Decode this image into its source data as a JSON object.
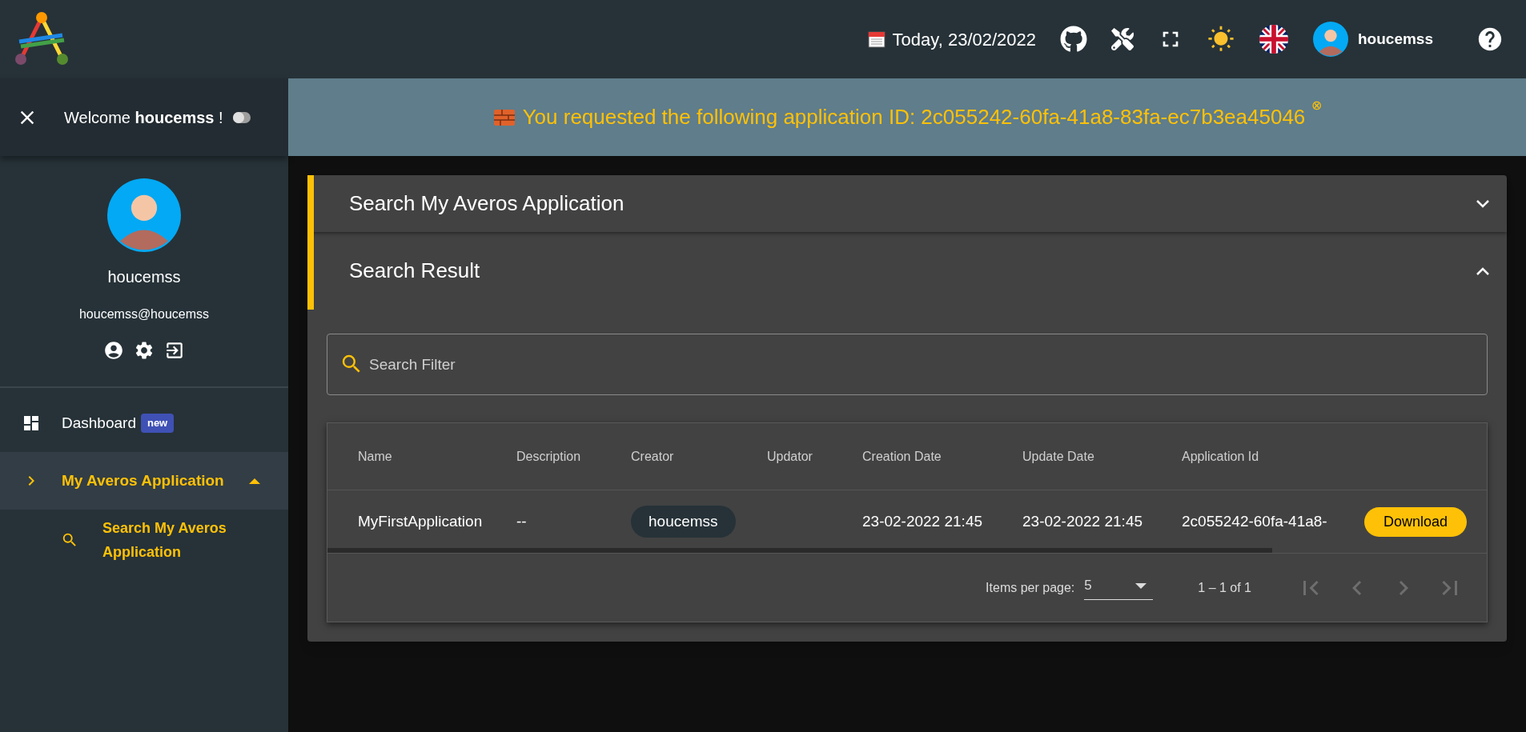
{
  "top_bar": {
    "date": "Today, 23/02/2022",
    "user_name": "houcemss"
  },
  "sidebar": {
    "welcome": "Welcome **houcemss** !",
    "theme_toggle": {
      "on": false
    },
    "profile": {
      "name": "houcemss",
      "email": "houcemss@houcemss"
    },
    "items": [
      {
        "label": "Dashboard",
        "badge": "new",
        "selected": false
      },
      {
        "label": "My Averos Application",
        "selected": true,
        "expanded": true,
        "children": [
          {
            "label": "Search My Averos Application",
            "selected": true
          }
        ]
      }
    ]
  },
  "banner": {
    "message": "You requested the following application ID: 2c055242-60fa-41a8-83fa-ec7b3ea45046",
    "dismiss": "⊗"
  },
  "panels": [
    {
      "title": "Search My Averos Application",
      "expanded": false
    },
    {
      "title": "Search Result",
      "expanded": true
    }
  ],
  "search": {
    "placeholder": "Search Filter"
  },
  "table": {
    "columns": [
      "Name",
      "Description",
      "Creator",
      "Updator",
      "Creation Date",
      "Update Date",
      "Application Id"
    ],
    "rows": [
      {
        "cells": [
          "MyFirstApplication",
          "--",
          "houcemss",
          "",
          "23-02-2022 21:45",
          "23-02-2022 21:45",
          "2c055242-60fa-41a8-"
        ],
        "action": "Download"
      }
    ]
  },
  "pagination": {
    "items_per_page_label": "Items per page:",
    "items_per_page": "5",
    "range": "1 – 1 of 1",
    "buttons": [
      {
        "kind": "first",
        "disabled": true
      },
      {
        "kind": "prev",
        "disabled": true
      },
      {
        "kind": "next",
        "disabled": true
      },
      {
        "kind": "last",
        "disabled": true
      }
    ]
  }
}
